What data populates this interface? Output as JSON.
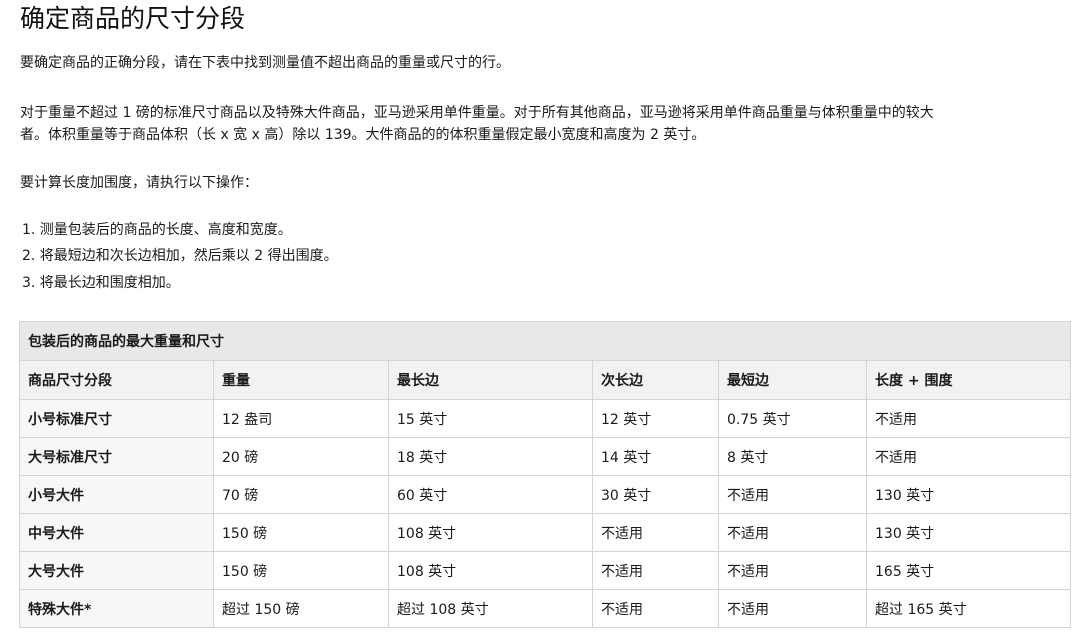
{
  "title": "确定商品的尺寸分段",
  "intro": "要确定商品的正确分段，请在下表中找到测量值不超出商品的重量或尺寸的行。",
  "weight_note_line1": "对于重量不超过 1 磅的标准尺寸商品以及特殊大件商品，亚马逊采用单件重量。对于所有其他商品，亚马逊将采用单件商品重量与体积重量中的较大",
  "weight_note_line2": "者。体积重量等于商品体积（长 x 宽 x 高）除以 139。大件商品的的体积重量假定最小宽度和高度为 2 英寸。",
  "calc_intro": "要计算长度加围度，请执行以下操作：",
  "steps": [
    "1. 测量包装后的商品的长度、高度和宽度。",
    "2. 将最短边和次长边相加，然后乘以 2 得出围度。",
    "3. 将最长边和围度相加。"
  ],
  "table": {
    "caption": "包装后的商品的最大重量和尺寸",
    "headers": [
      "商品尺寸分段",
      "重量",
      "最长边",
      "次长边",
      "最短边",
      "长度 + 围度"
    ],
    "rows": [
      [
        "小号标准尺寸",
        "12 盎司",
        "15 英寸",
        "12 英寸",
        "0.75 英寸",
        "不适用"
      ],
      [
        "大号标准尺寸",
        "20 磅",
        "18 英寸",
        "14 英寸",
        "8 英寸",
        "不适用"
      ],
      [
        "小号大件",
        "70 磅",
        "60 英寸",
        "30 英寸",
        "不适用",
        "130 英寸"
      ],
      [
        "中号大件",
        "150 磅",
        "108 英寸",
        "不适用",
        "不适用",
        "130 英寸"
      ],
      [
        "大号大件",
        "150 磅",
        "108 英寸",
        "不适用",
        "不适用",
        "165 英寸"
      ],
      [
        "特殊大件*",
        "超过 150 磅",
        "超过 108 英寸",
        "不适用",
        "不适用",
        "超过 165 英寸"
      ]
    ]
  }
}
